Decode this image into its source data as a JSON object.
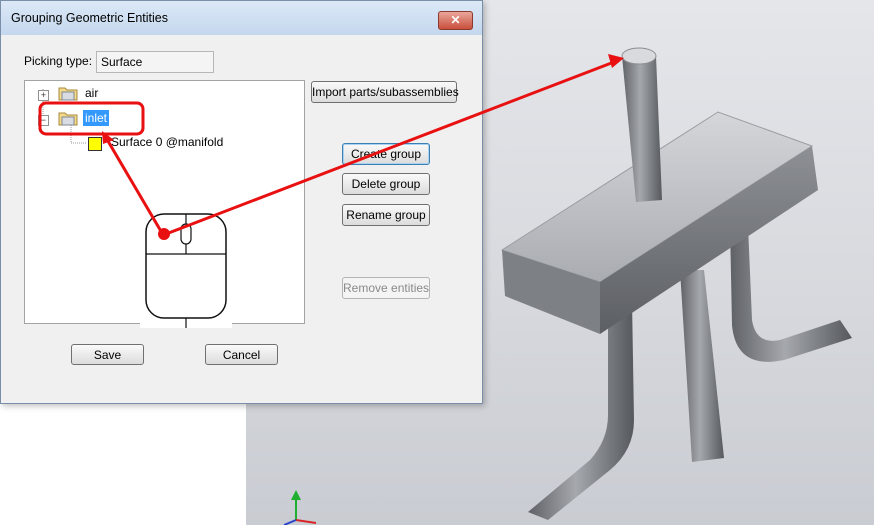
{
  "dialog": {
    "title": "Grouping Geometric Entities",
    "close_label": "✕",
    "picking_type_label": "Picking type:",
    "picking_type_value": "Surface",
    "tree": {
      "groups": [
        {
          "label": "air",
          "expander": "+"
        },
        {
          "label": "inlet",
          "expander": "−",
          "selected": true,
          "children": [
            {
              "label": "Surface 0 @manifold"
            }
          ]
        }
      ]
    },
    "buttons": {
      "import": "Import parts/subassemblies",
      "create": "Create group",
      "delete": "Delete group",
      "rename": "Rename group",
      "remove": "Remove entities",
      "save": "Save",
      "cancel": "Cancel"
    }
  },
  "colors": {
    "annotation": "#e81010",
    "selection": "#3399ff",
    "surface_swatch": "#ffff00"
  },
  "icons": [
    "folder-icon",
    "mouse-icon",
    "axis-triad-icon"
  ]
}
